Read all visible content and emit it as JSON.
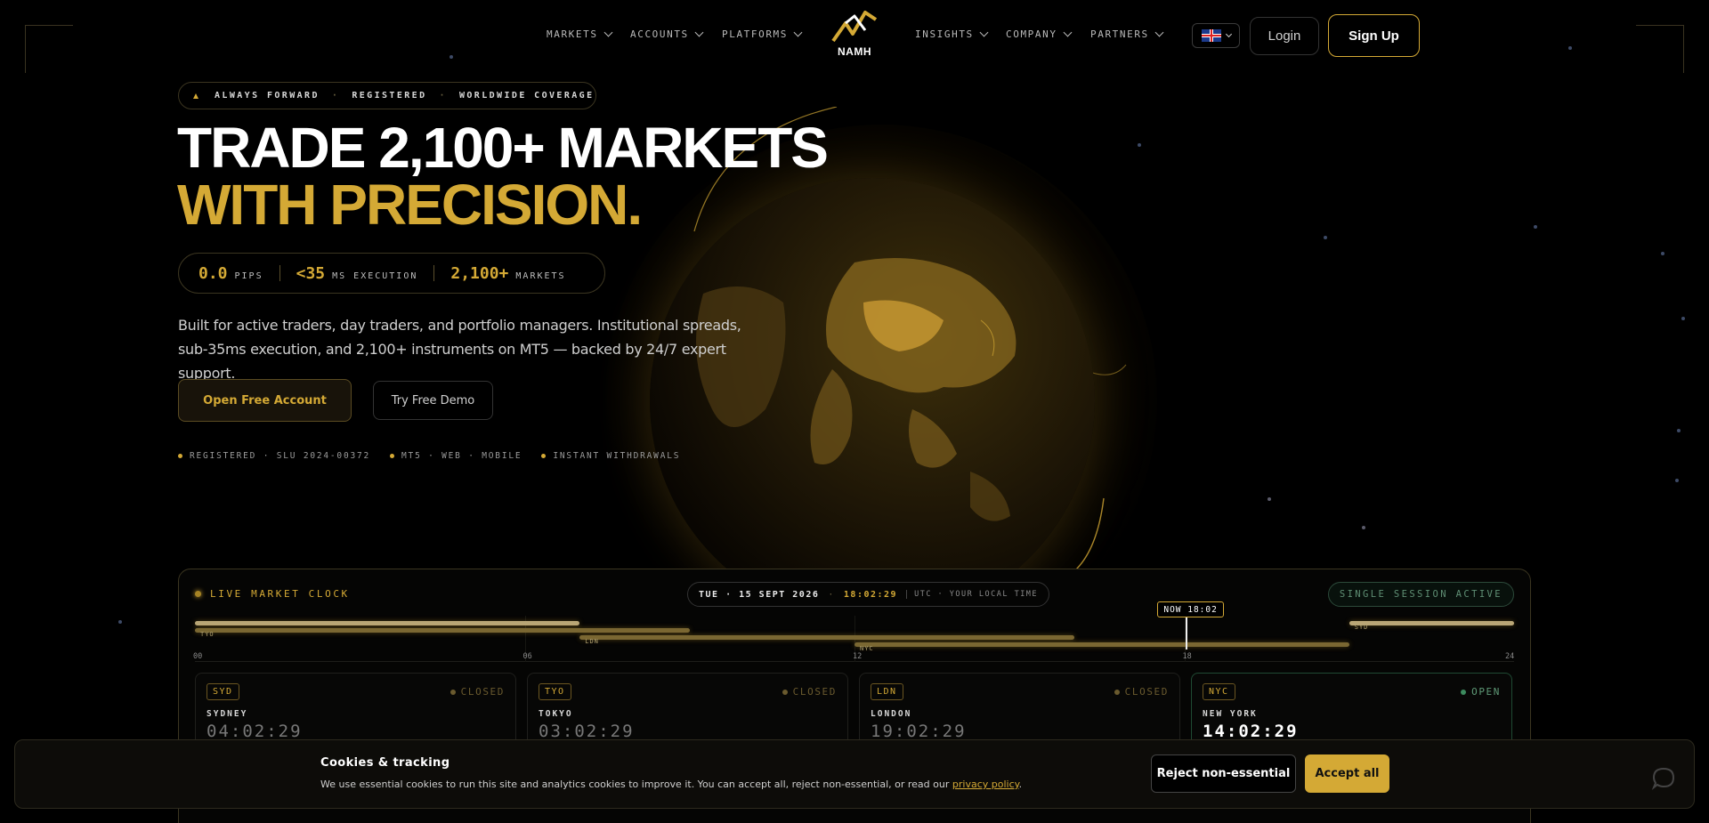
{
  "nav": {
    "left_items": [
      {
        "label": "MARKETS"
      },
      {
        "label": "ACCOUNTS"
      },
      {
        "label": "PLATFORMS"
      }
    ],
    "right_items": [
      {
        "label": "INSIGHTS"
      },
      {
        "label": "COMPANY"
      },
      {
        "label": "PARTNERS"
      }
    ],
    "logo_text": "NAMH",
    "language_icon": "uk-flag-icon",
    "login_label": "Login",
    "signup_label": "Sign Up"
  },
  "hero": {
    "tagline": [
      "ALWAYS FORWARD",
      "REGISTERED",
      "WORLDWIDE COVERAGE"
    ],
    "headline_line1": "TRADE 2,100+ MARKETS",
    "headline_line2": "WITH PRECISION.",
    "stats": [
      {
        "value": "0.0",
        "unit": "PIPS"
      },
      {
        "value": "<35",
        "unit": "MS EXECUTION"
      },
      {
        "value": "2,100+",
        "unit": "MARKETS"
      }
    ],
    "description": "Built for active traders, day traders, and portfolio managers. Institutional spreads, sub-35ms execution, and 2,100+ instruments on MT5 — backed by 24/7 expert support.",
    "primary_cta": "Open Free Account",
    "secondary_cta": "Try Free Demo",
    "badges": [
      "REGISTERED · SLU 2024-00372",
      "MT5 · WEB · MOBILE",
      "INSTANT WITHDRAWALS"
    ]
  },
  "clock": {
    "title": "LIVE MARKET CLOCK",
    "date": "TUE · 15 SEPT 2026",
    "time": "18:02:29",
    "zone": "UTC · YOUR LOCAL TIME",
    "session_status": "SINGLE SESSION ACTIVE",
    "now_label": "NOW 18:02",
    "now_hour": 18.03,
    "hours": [
      "00",
      "06",
      "12",
      "18",
      "24"
    ],
    "sessions": [
      {
        "code": "SYD",
        "start": 21,
        "end": 24,
        "start2": 0,
        "end2": 7
      },
      {
        "code": "TYO",
        "start": 0,
        "end": 9
      },
      {
        "code": "LDN",
        "start": 7,
        "end": 16
      },
      {
        "code": "NYC",
        "start": 12,
        "end": 21
      }
    ],
    "markets": [
      {
        "code": "SYD",
        "status": "CLOSED",
        "city": "SYDNEY",
        "time": "04:02:29",
        "open": false
      },
      {
        "code": "TYO",
        "status": "CLOSED",
        "city": "TOKYO",
        "time": "03:02:29",
        "open": false
      },
      {
        "code": "LDN",
        "status": "CLOSED",
        "city": "LONDON",
        "time": "19:02:29",
        "open": false
      },
      {
        "code": "NYC",
        "status": "OPEN",
        "city": "NEW YORK",
        "time": "14:02:29",
        "open": true
      }
    ]
  },
  "cookies": {
    "title": "Cookies & tracking",
    "text": "We use essential cookies to run this site and analytics cookies to improve it. You can accept all, reject non-essential, or read our ",
    "link": "privacy policy",
    "text_end": ".",
    "reject_label": "Reject non-essential",
    "accept_label": "Accept all"
  },
  "colors": {
    "accent": "#d4a935",
    "open_green": "#3c8b5e",
    "background": "#000000"
  }
}
